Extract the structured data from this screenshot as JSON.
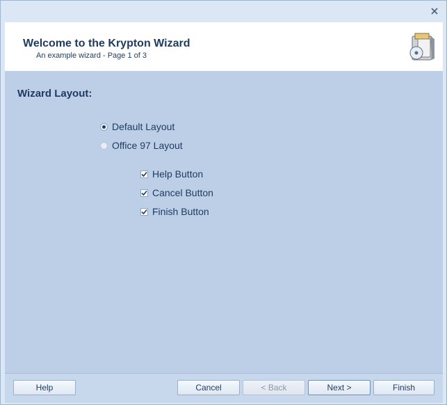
{
  "window": {
    "close_icon": "close-icon"
  },
  "header": {
    "title": "Welcome to the Krypton Wizard",
    "subtitle": "An example wizard - Page 1 of 3",
    "icon": "wizard-box-icon"
  },
  "main": {
    "group_title": "Wizard Layout:",
    "layout_options": [
      {
        "label": "Default Layout",
        "checked": true
      },
      {
        "label": "Office 97 Layout",
        "checked": false
      }
    ],
    "button_options": [
      {
        "label": "Help Button",
        "checked": true
      },
      {
        "label": "Cancel Button",
        "checked": true
      },
      {
        "label": "Finish Button",
        "checked": true
      }
    ]
  },
  "footer": {
    "help_label": "Help",
    "cancel_label": "Cancel",
    "back_label": "< Back",
    "next_label": "Next >",
    "finish_label": "Finish"
  },
  "colors": {
    "accent": "#1e3a5f",
    "panel": "#bccfe6",
    "footer": "#c8d8ec"
  }
}
